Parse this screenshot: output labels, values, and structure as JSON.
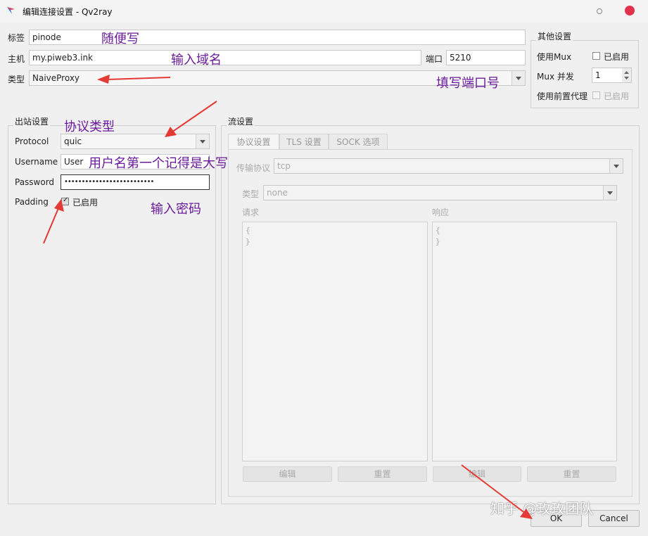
{
  "window": {
    "title": "编辑连接设置 - Qv2ray"
  },
  "top_form": {
    "tag_label": "标签",
    "tag_value": "pinode",
    "host_label": "主机",
    "host_value": "my.piweb3.ink",
    "port_label": "端口",
    "port_value": "5210",
    "type_label": "类型",
    "type_value": "NaiveProxy"
  },
  "other_settings": {
    "title": "其他设置",
    "mux_label": "使用Mux",
    "mux_enabled_label": "已启用",
    "mux_concurrency_label": "Mux 并发",
    "mux_concurrency_value": "1",
    "proxy_label": "使用前置代理",
    "proxy_enabled_label": "已启用"
  },
  "outbound": {
    "title": "出站设置",
    "protocol_label": "Protocol",
    "protocol_value": "quic",
    "username_label": "Username",
    "username_value": "User",
    "password_label": "Password",
    "password_value": "••••••••••••••••••••••••••",
    "padding_label": "Padding",
    "padding_enabled_label": "已启用"
  },
  "stream": {
    "title": "流设置",
    "tabs": [
      "协议设置",
      "TLS 设置",
      "SOCK 选项"
    ],
    "transport_label": "传输协议",
    "transport_value": "tcp",
    "type_label": "类型",
    "type_value": "none",
    "request_label": "请求",
    "response_label": "响应",
    "request_text": "{\n}",
    "response_text": "{\n}",
    "edit_label": "编辑",
    "reset_label": "重置"
  },
  "footer": {
    "ok_label": "OK",
    "cancel_label": "Cancel"
  },
  "annotations": {
    "a1": "随便写",
    "a2": "输入域名",
    "a3": "填写端口号",
    "a4": "协议类型",
    "a5": "用户名第一个记得是大写",
    "a6": "输入密码"
  },
  "watermark": "知乎 @玫玫团队",
  "colors": {
    "annotation": "#6a1b9a",
    "arrow": "#e53935",
    "close_button": "#e0334b"
  }
}
